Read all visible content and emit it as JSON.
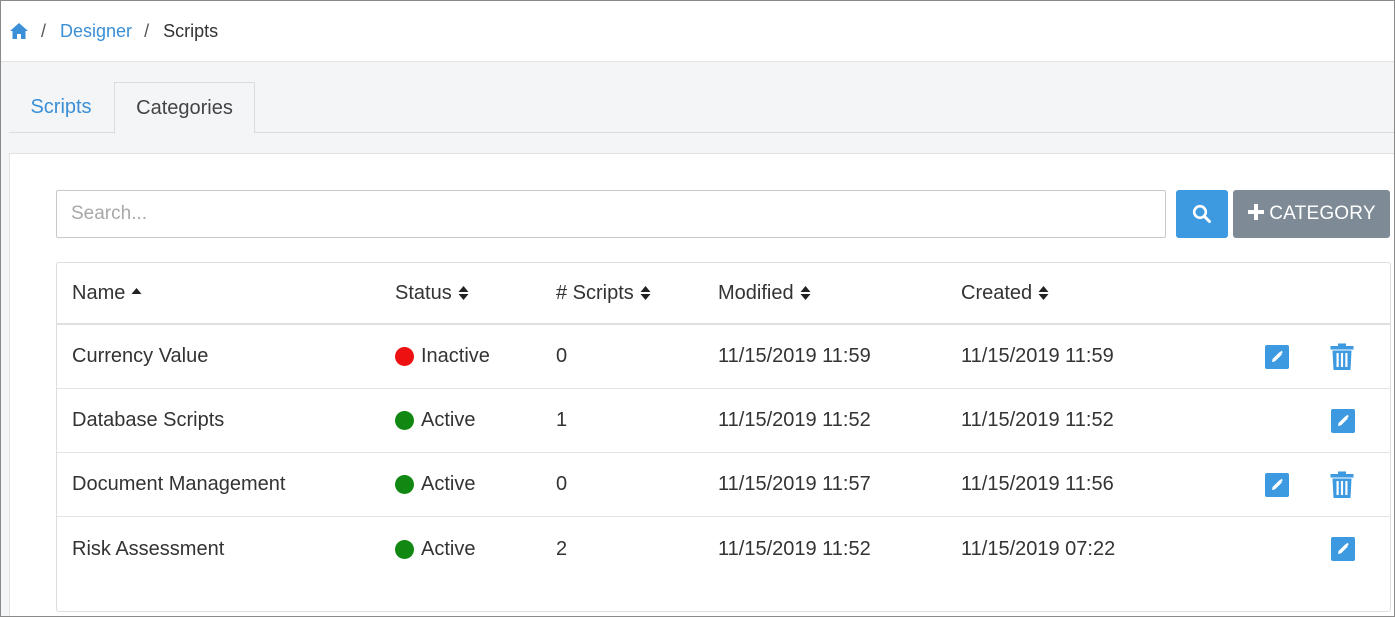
{
  "breadcrumb": {
    "home_icon": "home-icon",
    "separator": "/",
    "items": [
      "Designer",
      "Scripts"
    ]
  },
  "tabs": [
    {
      "label": "Scripts",
      "active": false
    },
    {
      "label": "Categories",
      "active": true
    }
  ],
  "search": {
    "placeholder": "Search...",
    "value": "",
    "button_icon": "search-icon"
  },
  "add_button": {
    "icon": "plus-icon",
    "label": "CATEGORY"
  },
  "table": {
    "columns": [
      {
        "label": "Name",
        "sort": "asc"
      },
      {
        "label": "Status",
        "sort": "both"
      },
      {
        "label": "# Scripts",
        "sort": "both"
      },
      {
        "label": "Modified",
        "sort": "both"
      },
      {
        "label": "Created",
        "sort": "both"
      }
    ],
    "rows": [
      {
        "name": "Currency Value",
        "status": "Inactive",
        "status_color": "#ee1111",
        "scripts": "0",
        "modified": "11/15/2019 11:59",
        "created": "11/15/2019 11:59",
        "deletable": true
      },
      {
        "name": "Database Scripts",
        "status": "Active",
        "status_color": "#118811",
        "scripts": "1",
        "modified": "11/15/2019 11:52",
        "created": "11/15/2019 11:52",
        "deletable": false
      },
      {
        "name": "Document Management",
        "status": "Active",
        "status_color": "#118811",
        "scripts": "0",
        "modified": "11/15/2019 11:57",
        "created": "11/15/2019 11:56",
        "deletable": true
      },
      {
        "name": "Risk Assessment",
        "status": "Active",
        "status_color": "#118811",
        "scripts": "2",
        "modified": "11/15/2019 11:52",
        "created": "11/15/2019 07:22",
        "deletable": false
      }
    ]
  },
  "colors": {
    "accent": "#3d99e0",
    "secondary_button": "#7e8b96",
    "link": "#3a8fd6"
  }
}
